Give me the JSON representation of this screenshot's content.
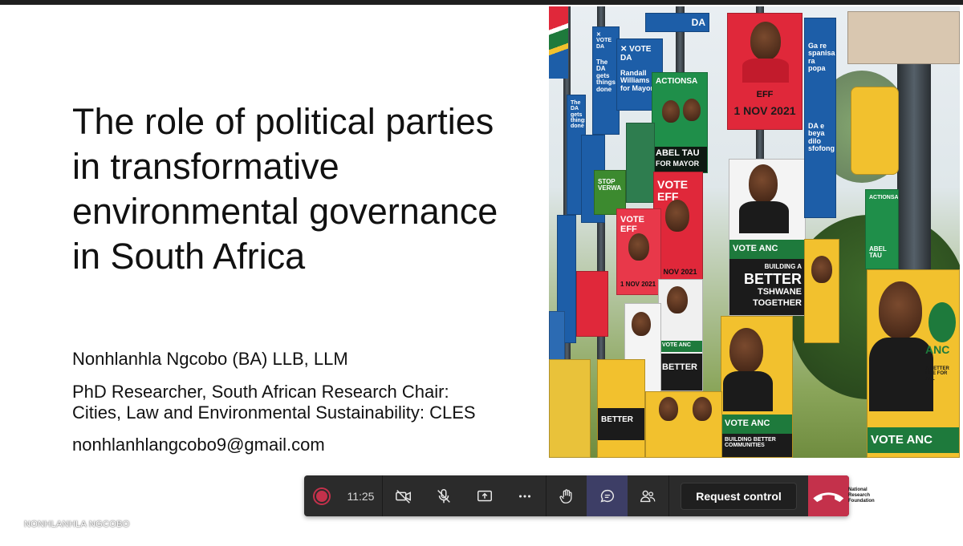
{
  "slide": {
    "title_lines": [
      "The role of political parties",
      "in transformative",
      "environmental governance",
      "in South Africa"
    ],
    "author": "Nonhlanhla Ngcobo (BA) LLB, LLM",
    "role_lines": [
      "PhD Researcher, South African Research Chair:",
      "Cities, Law and Environmental Sustainability: CLES"
    ],
    "email": "nonhlanhlangcobo9@gmail.com"
  },
  "posters": {
    "da_tag": "DA",
    "da_vote": "✕ VOTE DA",
    "da_randall": "Randall Williams for Mayor",
    "da_gets": "The DA gets things done",
    "da_sepedi": "Ga re spanisana ra popa",
    "da_beya": "DA e beya dilo sfofong",
    "actionsa": "ACTIONSA",
    "abel_tau": "ABEL TAU",
    "for_mayor": "FOR MAYOR",
    "vote_eff": "VOTE EFF",
    "eff_date": "1 NOV 2021",
    "eff": "EFF",
    "building_a": "BUILDING A",
    "better": "BETTER",
    "tshwane": "TSHWANE",
    "together": "TOGETHER",
    "vote_anc": "VOTE ANC",
    "anc": "ANC",
    "better_life": "A BETTER LIFE FOR ALL",
    "stop_verwa": "STOP VERWA",
    "better_communities": "BUILDING BETTER COMMUNITIES"
  },
  "toolbar": {
    "timer": "11:25",
    "request_control": "Request control"
  },
  "logo": {
    "lines": [
      "National",
      "Research",
      "Foundation"
    ]
  },
  "presenter_name": "NONHLANHLA NGCOBO",
  "colors": {
    "toolbar_bg": "#2b2b2b",
    "hangup": "#c4314b",
    "record": "#c4314b",
    "active_chat": "#3d3e66",
    "eff_red": "#e0283a",
    "da_blue": "#1d5ea8",
    "anc_green": "#1e7a3c",
    "anc_yellow": "#f2c12e"
  }
}
